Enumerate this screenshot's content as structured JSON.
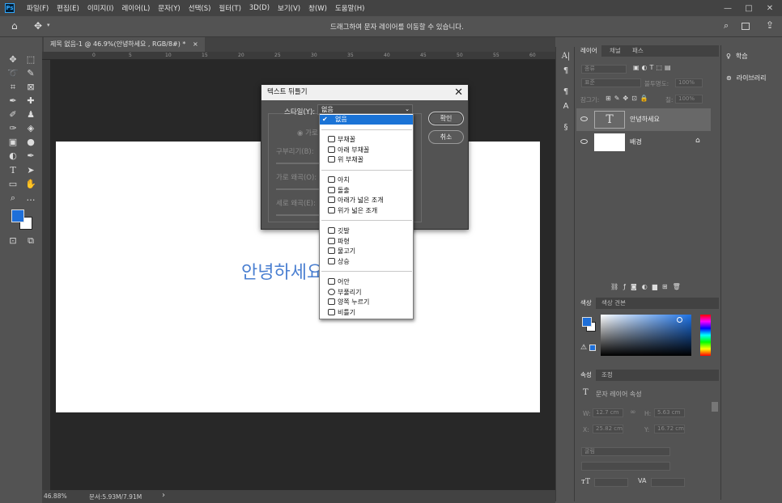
{
  "app": {
    "logo": "Ps"
  },
  "menu": [
    "파일(F)",
    "편집(E)",
    "이미지(I)",
    "레이어(L)",
    "문자(Y)",
    "선택(S)",
    "필터(T)",
    "3D(D)",
    "보기(V)",
    "창(W)",
    "도움말(H)"
  ],
  "window_controls": [
    "—",
    "□",
    "✕"
  ],
  "options_bar": {
    "hint": "드래그하여 문자 레이어를 이동할 수 있습니다."
  },
  "document": {
    "tab_title": "제목 없음-1 @ 46.9%(안녕하세요 , RGB/8#) *",
    "tab_close": "×",
    "canvas_text": "안녕하세요",
    "ruler_ticks": [
      "0",
      "5",
      "10",
      "15",
      "20",
      "25",
      "30",
      "35",
      "40",
      "45",
      "50",
      "55",
      "60",
      "65"
    ]
  },
  "status": {
    "zoom": "46.88%",
    "doc_info": "문서:5.93M/7.91M",
    "arrow": "›"
  },
  "dialog": {
    "title": "텍스트 뒤틀기",
    "close": "✕",
    "style_label": "스타일(Y):",
    "style_value": "없음",
    "ok": "확인",
    "cancel": "취소",
    "orientation": "가로",
    "bend_label": "구부리기(B):",
    "hdist_label": "가로 왜곡(O):",
    "vdist_label": "세로 왜곡(E):"
  },
  "dropdown": {
    "selected": "없음",
    "check": "✔",
    "groups": [
      [
        "부채꼴",
        "아래 부채꼴",
        "위 부채꼴"
      ],
      [
        "아치",
        "돌출",
        "아래가 넓은 조개",
        "위가 넓은 조개"
      ],
      [
        "깃발",
        "파형",
        "물고기",
        "상승"
      ],
      [
        "어안",
        "부풀리기",
        "양쪽 누르기",
        "비틀기"
      ]
    ]
  },
  "layers_panel": {
    "tabs": [
      "레이어",
      "채널",
      "패스"
    ],
    "filter": "종류",
    "blend_mode": "표준",
    "opacity_label": "불투명도:",
    "opacity": "100%",
    "lock_label": "잠그기:",
    "fill_label": "칠:",
    "fill": "100%",
    "layers": [
      {
        "name": "안녕하세요",
        "thumb": "T"
      },
      {
        "name": "배경"
      }
    ]
  },
  "color_panel": {
    "tabs": [
      "색상",
      "색상 견본"
    ],
    "foreground": "#1e6fd9",
    "background": "#ffffff"
  },
  "properties_panel": {
    "tabs": [
      "속성",
      "조정"
    ],
    "title": "문자 레이어 속성",
    "w_label": "W:",
    "w": "12.7 cm",
    "h_label": "H:",
    "h": "5.63 cm",
    "x_label": "X:",
    "x": "25.82 cm",
    "y_label": "Y:",
    "y": "16.72 cm",
    "font": "굴림"
  },
  "learn_panel": {
    "items": [
      "학습",
      "라이브러리"
    ]
  }
}
